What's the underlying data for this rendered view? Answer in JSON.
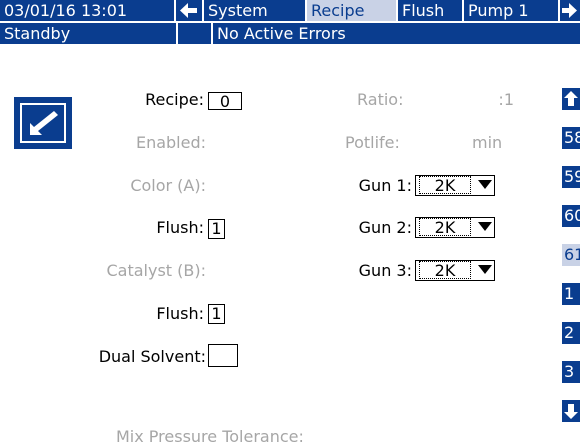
{
  "header": {
    "datetime": "03/01/16 13:01",
    "tabs": [
      {
        "label": "System"
      },
      {
        "label": "Recipe"
      },
      {
        "label": "Flush"
      },
      {
        "label": "Pump 1"
      }
    ],
    "icons": {
      "back": "left-arrow-icon",
      "forward": "right-arrow-icon"
    }
  },
  "status": {
    "mode": "Standby",
    "errors": "No Active Errors"
  },
  "form": {
    "recipe_label": "Recipe:",
    "recipe_value": "0",
    "enabled_label": "Enabled:",
    "color_label": "Color (A):",
    "flush_a_label": "Flush:",
    "flush_a_value": "1",
    "catalyst_label": "Catalyst (B):",
    "flush_b_label": "Flush:",
    "flush_b_value": "1",
    "dual_solvent_label": "Dual Solvent:",
    "ratio_label": "Ratio:",
    "ratio_value": ":1",
    "potlife_label": "Potlife:",
    "potlife_unit": "min",
    "gun1_label": "Gun 1:",
    "gun1_value": "2K",
    "gun2_label": "Gun 2:",
    "gun2_value": "2K",
    "gun3_label": "Gun 3:",
    "gun3_value": "2K",
    "mix_pressure_label": "Mix Pressure Tolerance:"
  },
  "sidebar": {
    "items": [
      {
        "label": "58"
      },
      {
        "label": "59"
      },
      {
        "label": "60"
      },
      {
        "label": "61"
      },
      {
        "label": "1"
      },
      {
        "label": "2"
      },
      {
        "label": "3"
      }
    ],
    "icons": {
      "up": "up-arrow-icon",
      "down": "down-arrow-icon"
    }
  },
  "colors": {
    "primary": "#0a3d8f",
    "selected": "#c9d2e6",
    "disabled_text": "#a6a6a6"
  }
}
